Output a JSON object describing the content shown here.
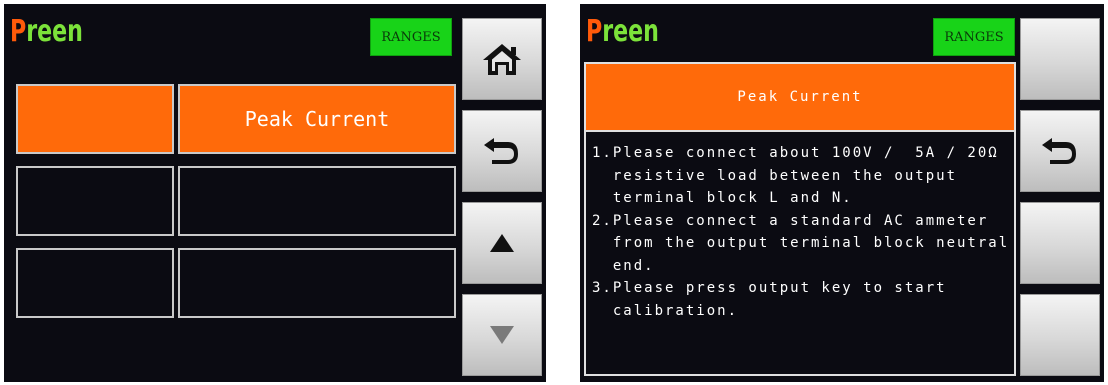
{
  "left_screen": {
    "logo": {
      "first": "P",
      "rest": "reen"
    },
    "ranges_label": "RANGES",
    "grid": [
      {
        "left": "",
        "right": "Peak Current",
        "active": true
      },
      {
        "left": "",
        "right": "",
        "active": false
      },
      {
        "left": "",
        "right": "",
        "active": false
      }
    ],
    "side_buttons": [
      "home-icon",
      "back-arrow-icon",
      "up-arrow-icon",
      "down-arrow-icon"
    ]
  },
  "right_screen": {
    "logo": {
      "first": "P",
      "rest": "reen"
    },
    "ranges_label": "RANGES",
    "panel_title": "Peak Current",
    "instructions": [
      "1.Please connect about 100V /  5A / 20Ω",
      "  resistive load between the output",
      "  terminal block L and N.",
      "2.Please connect a standard AC ammeter",
      "  from the output terminal block neutral",
      "  end.",
      "3.Please press output key to start",
      "  calibration."
    ],
    "side_buttons": [
      "blank",
      "back-arrow-icon",
      "blank",
      "blank"
    ]
  },
  "colors": {
    "accent_orange": "#ff6a0a",
    "ranges_green": "#18d318",
    "screen_bg": "#0b0b12"
  }
}
